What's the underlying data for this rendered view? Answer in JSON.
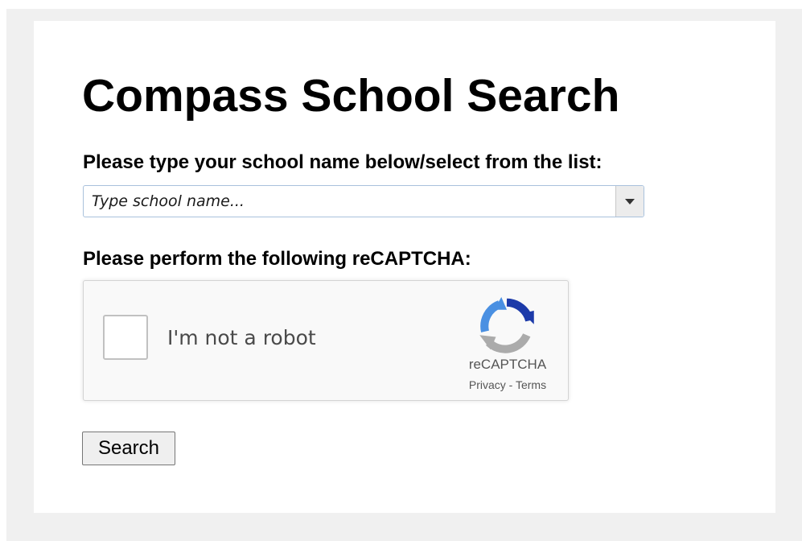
{
  "page": {
    "title": "Compass School Search"
  },
  "school_search": {
    "label": "Please type your school name below/select from the list:",
    "placeholder": "Type school name...",
    "value": ""
  },
  "captcha": {
    "label": "Please perform the following reCAPTCHA:",
    "checkbox_text": "I'm not a robot",
    "brand": "reCAPTCHA",
    "privacy_link": "Privacy",
    "separator": " - ",
    "terms_link": "Terms",
    "logo_icon": "recaptcha-logo-icon"
  },
  "actions": {
    "search_label": "Search"
  },
  "colors": {
    "outer_background": "#f0f0f0",
    "card_background": "#ffffff",
    "captcha_background": "#f9f9f9",
    "recaptcha_blue": "#1c3aa9",
    "recaptcha_light_blue": "#4a90e2",
    "recaptcha_gray": "#ababab"
  }
}
